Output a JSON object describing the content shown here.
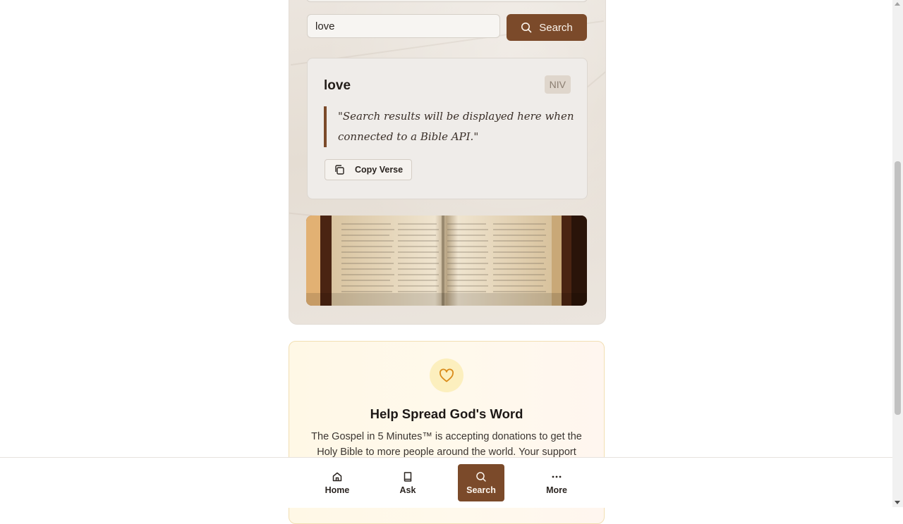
{
  "search": {
    "input_value": "love",
    "button_label": "Search"
  },
  "result": {
    "title": "love",
    "version": "NIV",
    "verse": "\"Search results will be displayed here when connected to a Bible API.\"",
    "copy_label": "Copy Verse"
  },
  "donate": {
    "title": "Help Spread God's Word",
    "text": "The Gospel in 5 Minutes™ is accepting donations to get the Holy Bible to more people around the world. Your support"
  },
  "nav": {
    "items": [
      {
        "label": "Home",
        "icon": "home-icon"
      },
      {
        "label": "Ask",
        "icon": "book-icon"
      },
      {
        "label": "Search",
        "icon": "search-icon"
      },
      {
        "label": "More",
        "icon": "more-icon"
      }
    ],
    "active": "Search"
  },
  "colors": {
    "accent": "#7b4a2a",
    "donate_bg": "#fff8e6",
    "heart": "#d98b1a"
  }
}
